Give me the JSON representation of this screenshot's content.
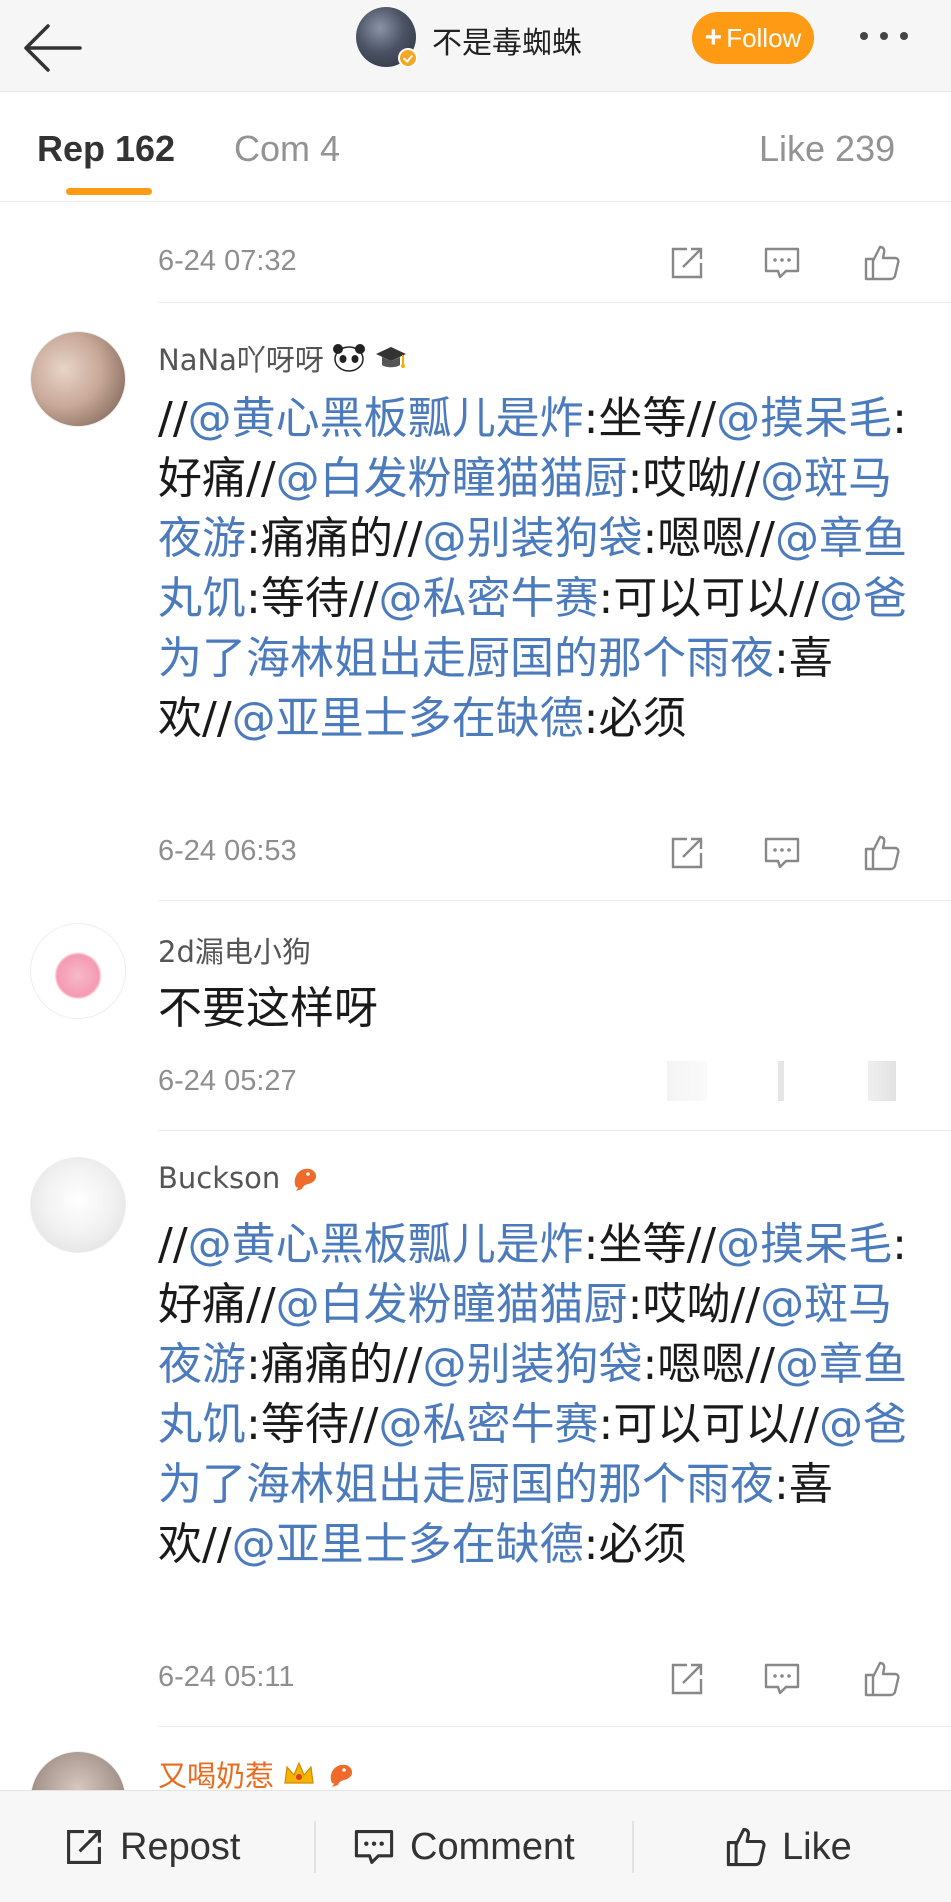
{
  "header": {
    "title": "不是毒蜘蛛",
    "follow_label": "Follow",
    "follow_plus": "+"
  },
  "tabs": [
    {
      "label": "Rep 162",
      "active": true
    },
    {
      "label": "Com 4",
      "active": false
    },
    {
      "label": "Like 239",
      "active": false
    }
  ],
  "comments": [
    {
      "time": "6-24 07:32"
    },
    {
      "name": "NaNa吖呀呀",
      "badges": [
        "panda-emoji-icon",
        "graduation-cap-emoji-icon"
      ],
      "text_segments": [
        {
          "t": "//",
          "m": false
        },
        {
          "t": "@黄心黑板瓢儿是炸",
          "m": true
        },
        {
          "t": ":坐等//",
          "m": false
        },
        {
          "t": "@摸呆毛",
          "m": true
        },
        {
          "t": ":好痛//",
          "m": false
        },
        {
          "t": "@白发粉瞳猫猫厨",
          "m": true
        },
        {
          "t": ":哎呦//",
          "m": false
        },
        {
          "t": "@斑马夜游",
          "m": true
        },
        {
          "t": ":痛痛的//",
          "m": false
        },
        {
          "t": "@别装狗袋",
          "m": true
        },
        {
          "t": ":嗯嗯//",
          "m": false
        },
        {
          "t": "@章鱼丸饥",
          "m": true
        },
        {
          "t": ":等待//",
          "m": false
        },
        {
          "t": "@私密牛赛",
          "m": true
        },
        {
          "t": ":可以可以//",
          "m": false
        },
        {
          "t": "@爸为了海林姐出走厨国的那个雨夜",
          "m": true
        },
        {
          "t": ":喜欢//",
          "m": false
        },
        {
          "t": "@亚里士多在缺德",
          "m": true
        },
        {
          "t": ":必须",
          "m": false
        }
      ],
      "time": "6-24 06:53"
    },
    {
      "name": "2d漏电小狗",
      "badges": [],
      "text_segments": [
        {
          "t": "不要这样呀",
          "m": false
        }
      ],
      "time": "6-24 05:27"
    },
    {
      "name": "Buckson",
      "badges": [
        "shrimp-emoji-icon"
      ],
      "text_segments": [
        {
          "t": "//",
          "m": false
        },
        {
          "t": "@黄心黑板瓢儿是炸",
          "m": true
        },
        {
          "t": ":坐等//",
          "m": false
        },
        {
          "t": "@摸呆毛",
          "m": true
        },
        {
          "t": ":好痛//",
          "m": false
        },
        {
          "t": "@白发粉瞳猫猫厨",
          "m": true
        },
        {
          "t": ":哎呦//",
          "m": false
        },
        {
          "t": "@斑马夜游",
          "m": true
        },
        {
          "t": ":痛痛的//",
          "m": false
        },
        {
          "t": "@别装狗袋",
          "m": true
        },
        {
          "t": ":嗯嗯//",
          "m": false
        },
        {
          "t": "@章鱼丸饥",
          "m": true
        },
        {
          "t": ":等待//",
          "m": false
        },
        {
          "t": "@私密牛赛",
          "m": true
        },
        {
          "t": ":可以可以//",
          "m": false
        },
        {
          "t": "@爸为了海林姐出走厨国的那个雨夜",
          "m": true
        },
        {
          "t": ":喜欢//",
          "m": false
        },
        {
          "t": "@亚里士多在缺德",
          "m": true
        },
        {
          "t": ":必须",
          "m": false
        }
      ],
      "time": "6-24 05:11"
    },
    {
      "name": "又喝奶惹",
      "badges": [
        "crown-emoji-icon",
        "shrimp-emoji-icon"
      ]
    }
  ],
  "bottom_bar": {
    "repost_label": "Repost",
    "comment_label": "Comment",
    "like_label": "Like"
  },
  "colors": {
    "accent": "#ff9a14",
    "mention": "#4c7bbd",
    "vip_name": "#e86b1f"
  }
}
